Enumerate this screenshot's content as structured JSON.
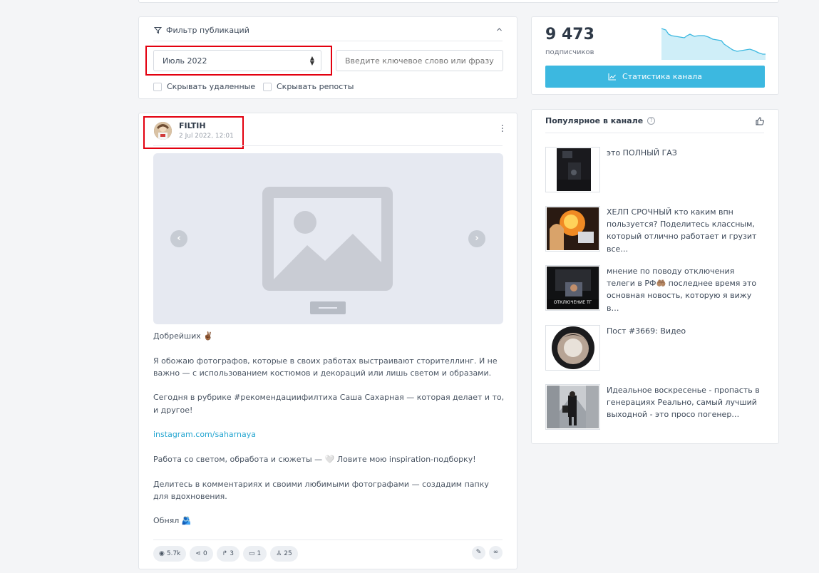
{
  "filter": {
    "title": "Фильтр публикаций",
    "toggle_icon": "chevron-up-icon",
    "month_value": "Июль 2022",
    "keyword_placeholder": "Введите ключевое слово или фразу",
    "checkbox_hide_deleted": "Скрывать удаленные",
    "checkbox_hide_reposts": "Скрывать репосты"
  },
  "post": {
    "author": "FILTIH",
    "date": "2 Jul 2022, 12:01",
    "paragraphs": [
      "Добрейших ✌🏾",
      "Я обожаю фотографов, которые в своих работах выстраивают сторителлинг. И не важно — с использованием костюмов и декораций или лишь светом и образами.",
      "Сегодня в рубрике #рекомендациифилтиха Саша Сахарная — которая делает и то, и другое!",
      "instagram.com/saharnaya",
      "Работа со светом, обработа и сюжеты — 🤍 Ловите мою inspiration-подборку!",
      "Делитесь в комментариях и своими любимыми фотографами — создадим папку для вдохновения.",
      "Обнял 🫂"
    ],
    "stats": {
      "views": "5.7k",
      "shares": "0",
      "reposts": "3",
      "comments": "1",
      "likes": "25"
    }
  },
  "subscribers": {
    "count": "9 473",
    "label": "подписчиков",
    "button": "Статистика канала"
  },
  "popular": {
    "title": "Популярное в канале",
    "items": [
      {
        "text": "это ПОЛНЫЙ ГАЗ"
      },
      {
        "text": "ХЕЛП СРОЧНЫЙ кто каким впн пользуется? Поделитесь классным, который отлично работает и грузит все…"
      },
      {
        "text": "мнение по поводу отключения телеги в РФ🤲🏽 последнее время это основная новость, которую я вижу в…",
        "thumb_caption": "ОТКЛЮЧЕНИЕ ТГ"
      },
      {
        "text": "Пост #3669: Видео"
      },
      {
        "text": "Идеальное воскресенье - пропасть в генерациях Реально, самый лучший выходной - это просо погенер…"
      }
    ]
  },
  "colors": {
    "accent": "#3cb8e0",
    "link": "#26a6d1",
    "highlight": "#e3000f",
    "background": "#f4f5f7"
  }
}
